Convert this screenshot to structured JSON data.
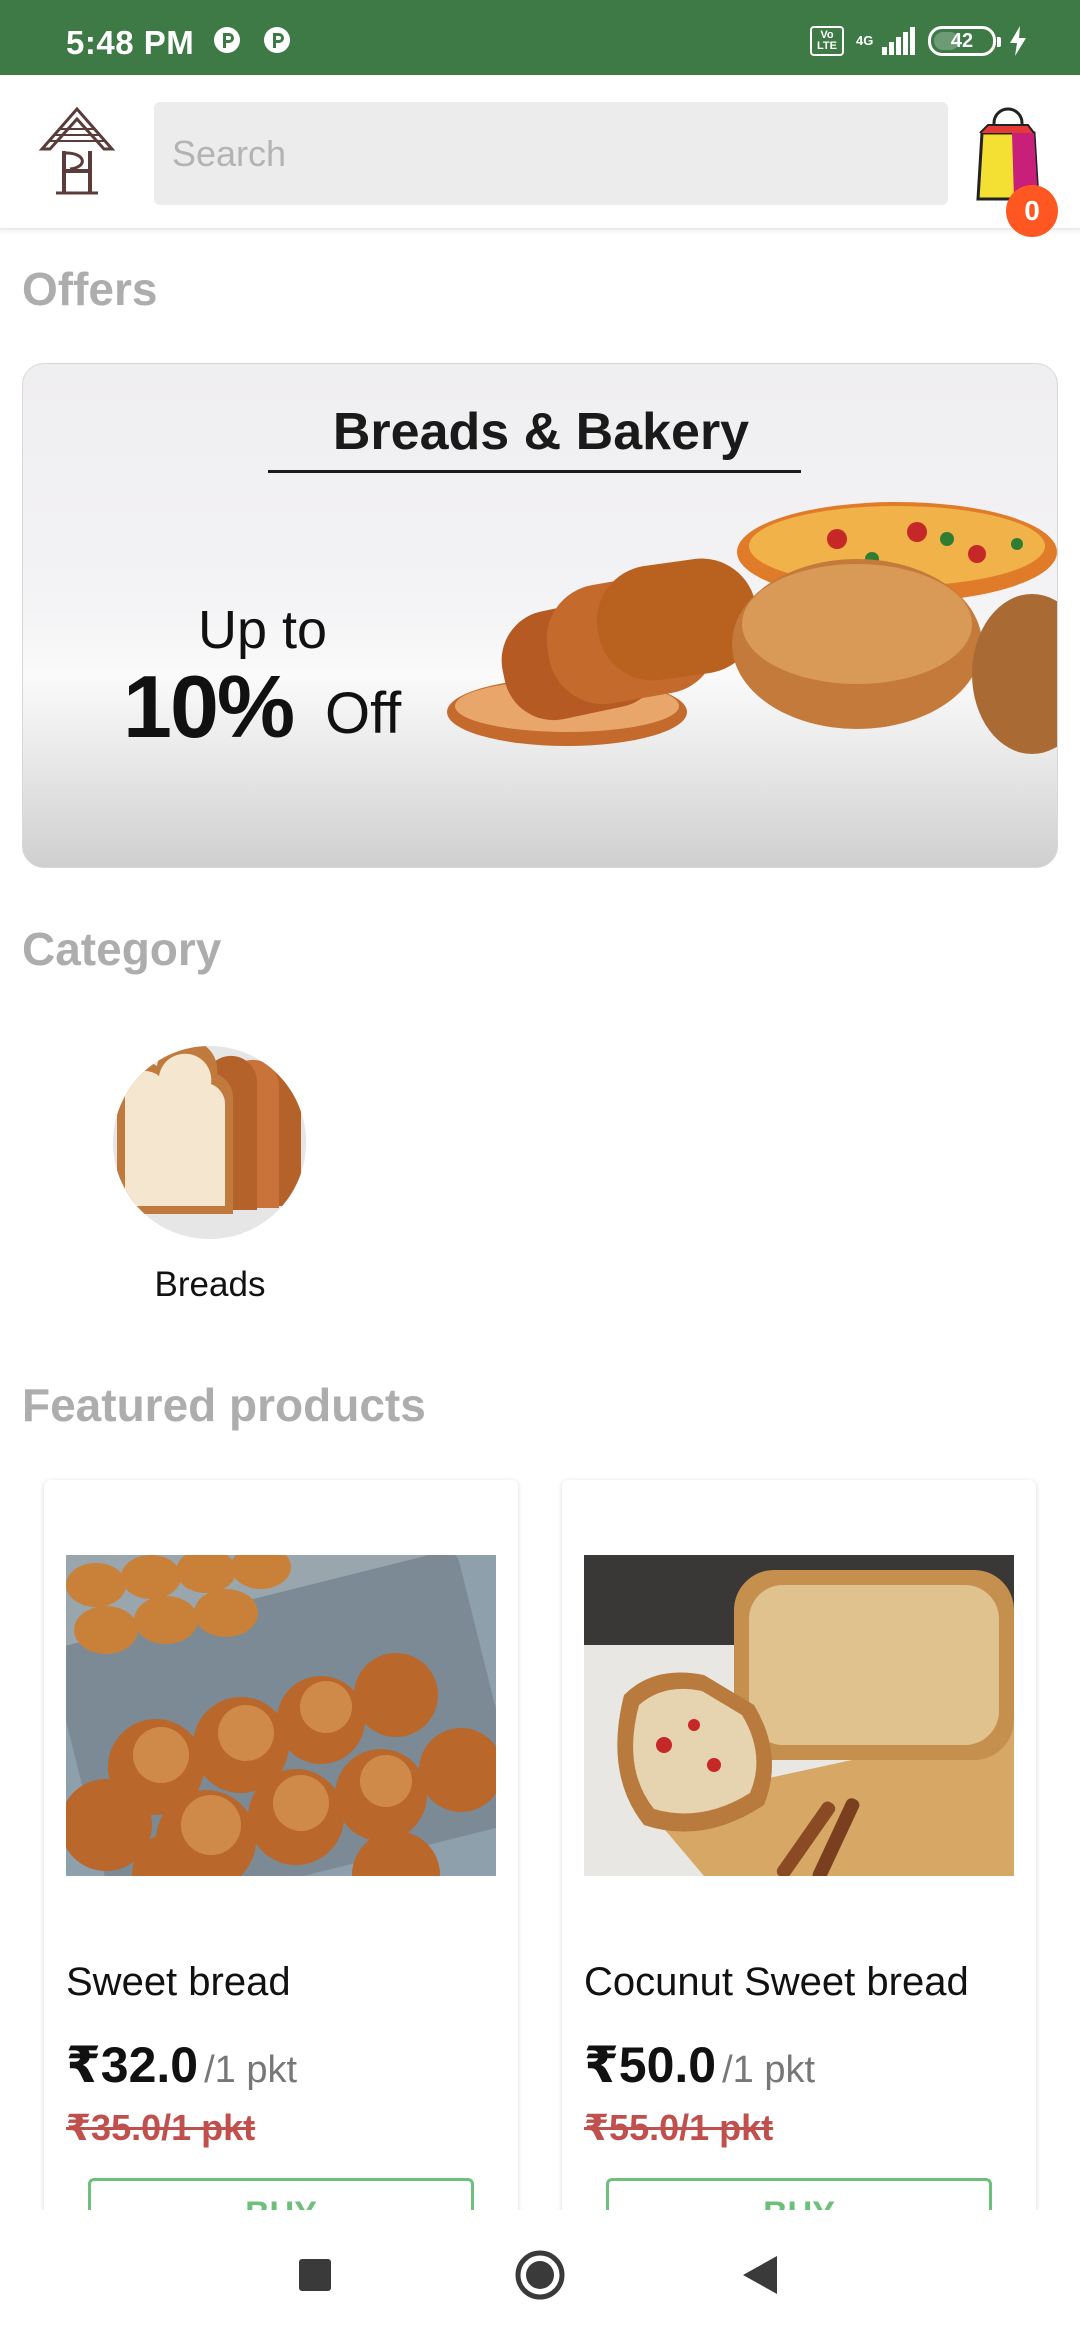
{
  "status_bar": {
    "time": "5:48 PM",
    "network": "4G",
    "volte": "Vo LTE",
    "battery": "42"
  },
  "header": {
    "search_placeholder": "Search",
    "cart_count": "0"
  },
  "offers": {
    "title": "Offers",
    "banner": {
      "headline": "Breads & Bakery",
      "up_to": "Up to",
      "percent": "10%",
      "off": "Off"
    }
  },
  "category": {
    "title": "Category",
    "items": [
      {
        "label": "Breads"
      }
    ]
  },
  "featured": {
    "title": "Featured products",
    "products": [
      {
        "name": "Sweet bread",
        "price": "₹32.0",
        "unit": "/1 pkt",
        "mrp": "₹35.0/1 pkt",
        "buy_label": "BUY"
      },
      {
        "name": "Cocunut Sweet bread",
        "price": "₹50.0",
        "unit": "/1 pkt",
        "mrp": "₹55.0/1 pkt",
        "buy_label": "BUY"
      }
    ]
  },
  "nav_bar": {
    "icons": [
      "recents-icon",
      "home-icon",
      "back-icon"
    ]
  },
  "colors": {
    "status_bar": "#3d7a45",
    "accent_green": "#6fbf7c",
    "badge": "#ff5722",
    "strike_price": "#c0504d",
    "section_title": "#adadad"
  }
}
